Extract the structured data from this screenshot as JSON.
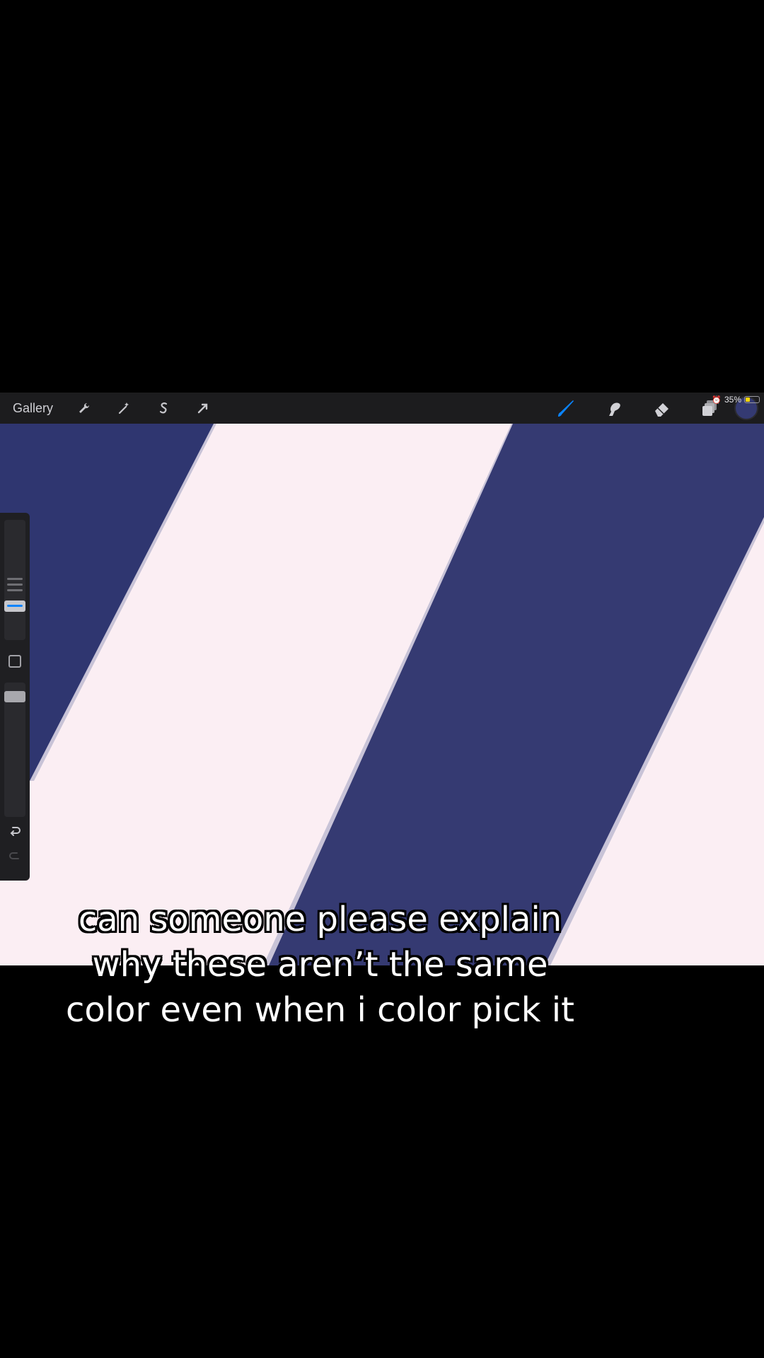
{
  "toolbar": {
    "gallery_label": "Gallery",
    "left_icons": [
      "wrench-icon",
      "magic-wand-icon",
      "selection-icon",
      "transform-arrow-icon"
    ],
    "right_icons": [
      "brush-icon",
      "smudge-icon",
      "eraser-icon",
      "layers-icon"
    ],
    "active_tool": "brush",
    "current_color": "#343a72"
  },
  "status": {
    "battery": "35%",
    "battery_level": 0.35
  },
  "canvas": {
    "background_color": "#fbeef3",
    "stripe_color_left": "#2f3670",
    "stripe_color_right": "#353a72"
  },
  "sidebar": {
    "brush_size_level": 0.3,
    "opacity_level": 0.95
  },
  "caption": {
    "line1": "can someone please explain",
    "line2": "why these aren’t the same",
    "line3": "color even when i color pick it"
  },
  "colors": {
    "accent": "#0a84ff",
    "toolbar_bg": "#1c1c1e"
  }
}
